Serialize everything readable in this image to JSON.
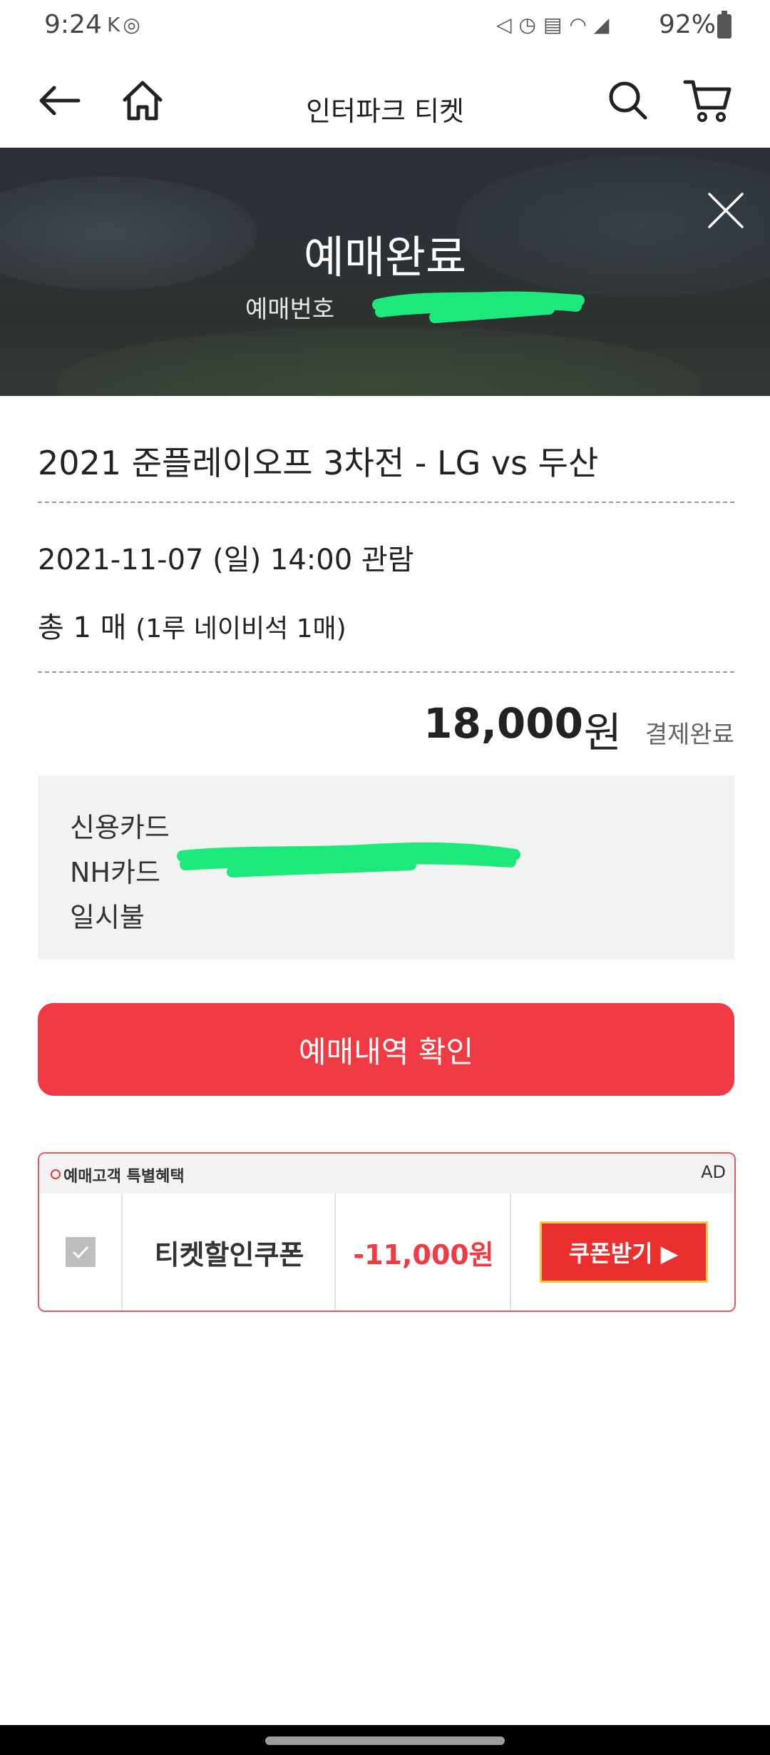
{
  "status_bar": {
    "time": "9:24",
    "battery": "92%",
    "left_icons": [
      "kakao-notification-icon",
      "walking-icon"
    ],
    "right_icons": [
      "mute-icon",
      "alarm-icon",
      "hd-voice-icon",
      "wifi-icon",
      "signal-icon",
      "battery-icon"
    ]
  },
  "header": {
    "title": "인터파크 티켓",
    "icons": [
      "back-arrow-icon",
      "home-icon",
      "search-icon",
      "cart-icon"
    ]
  },
  "banner": {
    "title": "예매완료",
    "booking_label": "예매번호",
    "close_icon": "close-icon"
  },
  "booking": {
    "match_title": "2021 준플레이오프 3차전 - LG vs 두산",
    "date_line": "2021-11-07 (일) 14:00 관람",
    "count_main": "총 1 매",
    "count_detail": "(1루 네이비석 1매)",
    "price": "18,000",
    "price_unit": "원",
    "payment_status": "결제완료"
  },
  "payment": {
    "method": "신용카드",
    "card": "NH카드",
    "installment": "일시불"
  },
  "confirm_button": "예매내역 확인",
  "ad": {
    "header_label": "예매고객 특별혜택",
    "tag": "AD",
    "coupon_name": "티켓할인쿠폰",
    "coupon_amount": "-11,000원",
    "coupon_button": "쿠폰받기 ▶"
  },
  "colors": {
    "accent_red": "#f03b44",
    "redaction_green": "#1de87a",
    "banner_dark": "#2c3137"
  }
}
